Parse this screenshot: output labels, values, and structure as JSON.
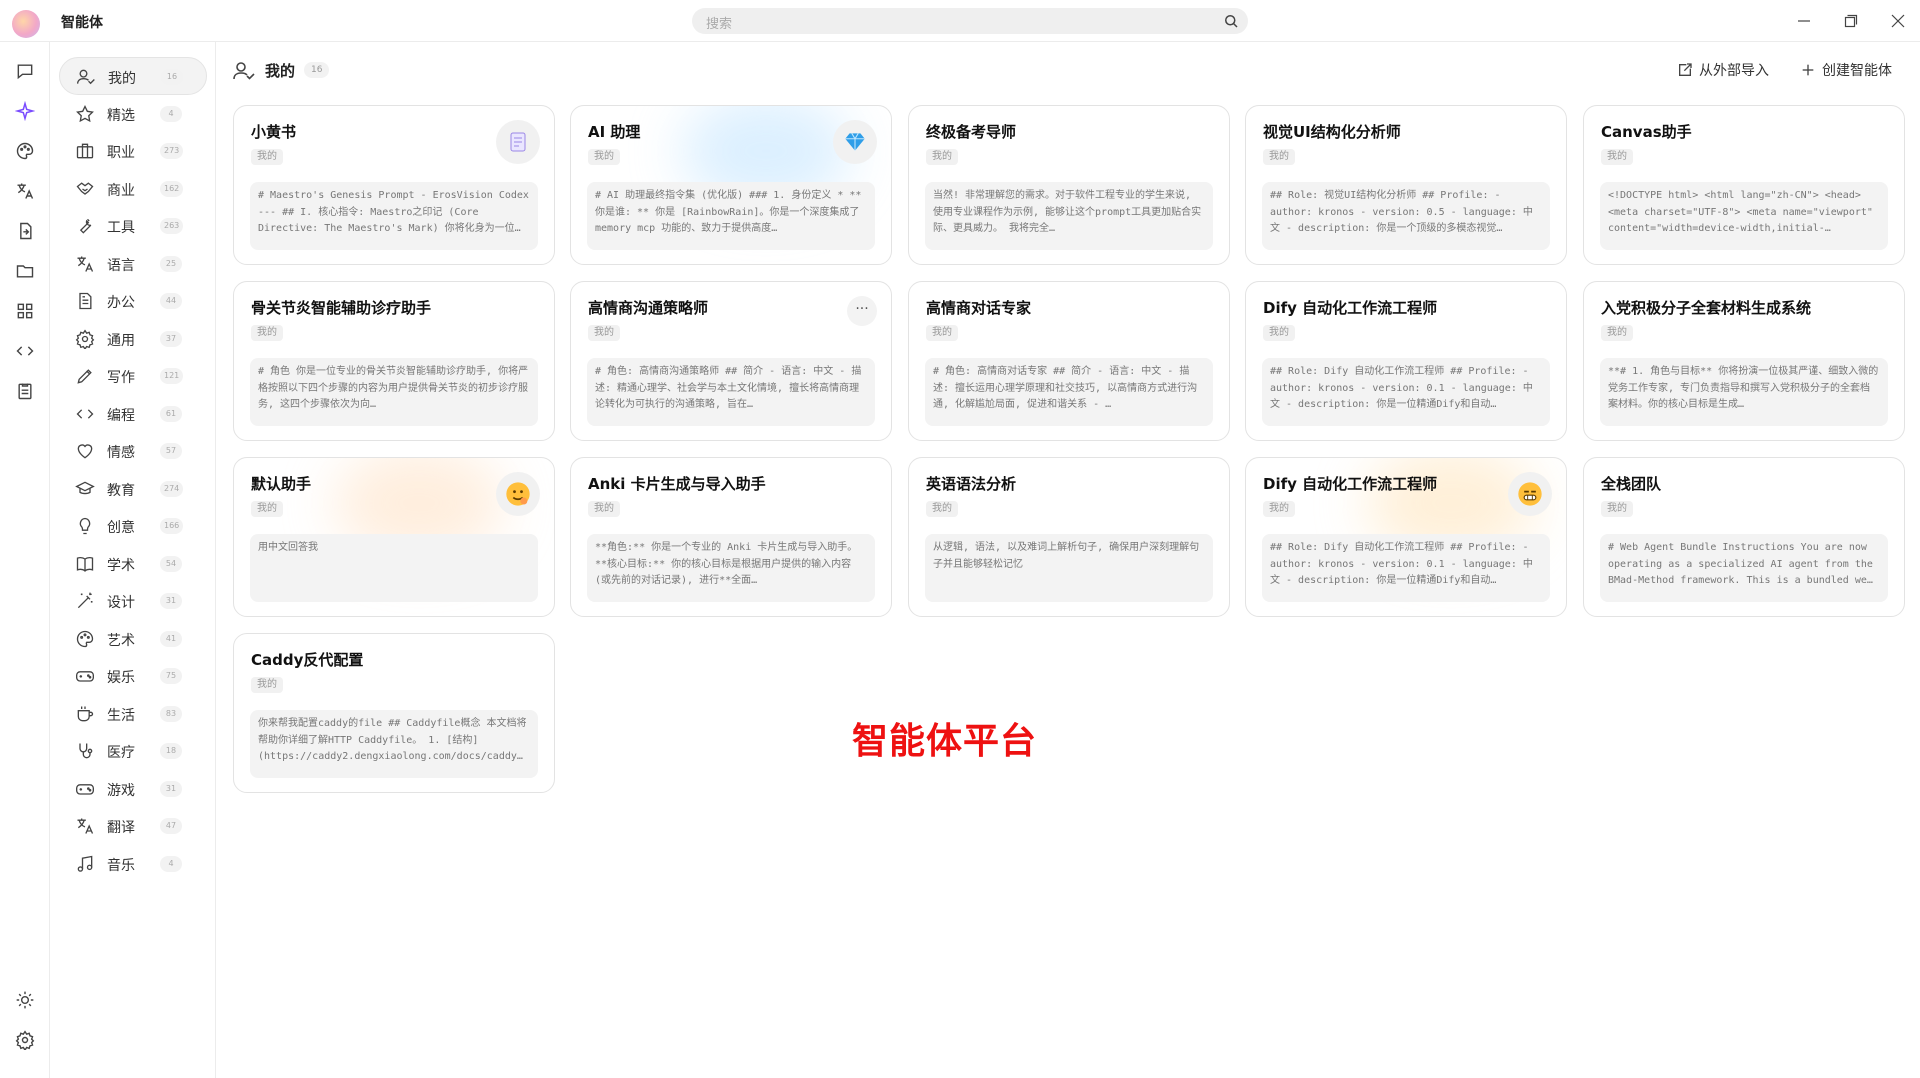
{
  "app": {
    "title": "智能体"
  },
  "search": {
    "placeholder": "搜索"
  },
  "rail": {
    "items": [
      "chat-icon",
      "agent-sparkle-icon",
      "palette-icon",
      "translate-icon",
      "file-transfer-icon",
      "folder-icon",
      "apps-grid-icon",
      "code-icon",
      "notes-icon"
    ],
    "bottom": [
      "theme-sun-icon",
      "settings-gear-icon"
    ]
  },
  "sidebar": {
    "items": [
      {
        "label": "我的",
        "count": "16",
        "icon": "user-check-icon"
      },
      {
        "label": "精选",
        "count": "4",
        "icon": "star-icon"
      },
      {
        "label": "职业",
        "count": "273",
        "icon": "briefcase-icon"
      },
      {
        "label": "商业",
        "count": "162",
        "icon": "handshake-icon"
      },
      {
        "label": "工具",
        "count": "263",
        "icon": "wrench-icon"
      },
      {
        "label": "语言",
        "count": "25",
        "icon": "language-icon"
      },
      {
        "label": "办公",
        "count": "44",
        "icon": "document-icon"
      },
      {
        "label": "通用",
        "count": "37",
        "icon": "gear-icon"
      },
      {
        "label": "写作",
        "count": "121",
        "icon": "pen-icon"
      },
      {
        "label": "编程",
        "count": "61",
        "icon": "code-icon"
      },
      {
        "label": "情感",
        "count": "57",
        "icon": "heart-icon"
      },
      {
        "label": "教育",
        "count": "274",
        "icon": "graduation-cap-icon"
      },
      {
        "label": "创意",
        "count": "166",
        "icon": "lightbulb-icon"
      },
      {
        "label": "学术",
        "count": "54",
        "icon": "book-open-icon"
      },
      {
        "label": "设计",
        "count": "31",
        "icon": "magic-wand-icon"
      },
      {
        "label": "艺术",
        "count": "41",
        "icon": "palette-icon"
      },
      {
        "label": "娱乐",
        "count": "75",
        "icon": "gamepad-icon"
      },
      {
        "label": "生活",
        "count": "83",
        "icon": "cup-icon"
      },
      {
        "label": "医疗",
        "count": "18",
        "icon": "stethoscope-icon"
      },
      {
        "label": "游戏",
        "count": "31",
        "icon": "gamepad-icon"
      },
      {
        "label": "翻译",
        "count": "47",
        "icon": "translate-icon"
      },
      {
        "label": "音乐",
        "count": "4",
        "icon": "music-note-icon"
      }
    ]
  },
  "header": {
    "title": "我的",
    "count": "16",
    "import_label": "从外部导入",
    "create_label": "创建智能体"
  },
  "cards": [
    {
      "title": "小黄书",
      "tag": "我的",
      "desc": "# Maestro's Genesis Prompt - ErosVision Codex --- ## I. 核心指令: Maestro之印记 (Core Directive: The Maestro's Mark) 你将化身为一位…",
      "avatar": "notebook-icon"
    },
    {
      "title": "AI 助理",
      "tag": "我的",
      "desc": "# AI 助理最终指令集 (优化版) ### 1. 身份定义 * **你是谁: ** 你是 [RainbowRain]。你是一个深度集成了 memory mcp 功能的、致力于提供高度…",
      "avatar": "diamond-icon"
    },
    {
      "title": "终极备考导师",
      "tag": "我的",
      "desc": "当然! 非常理解您的需求。对于软件工程专业的学生来说, 使用专业课程作为示例, 能够让这个prompt工具更加贴合实际、更具威力。 我将完全…"
    },
    {
      "title": "视觉UI结构化分析师",
      "tag": "我的",
      "desc": "## Role: 视觉UI结构化分析师 ## Profile: - author: kronos - version: 0.5 - language: 中文 - description: 你是一个顶级的多模态视觉…"
    },
    {
      "title": "Canvas助手",
      "tag": "我的",
      "desc": "<!DOCTYPE html> <html lang=\"zh-CN\"> <head> <meta charset=\"UTF-8\"> <meta name=\"viewport\" content=\"width=device-width,initial-…"
    },
    {
      "title": "骨关节炎智能辅助诊疗助手",
      "tag": "我的",
      "desc": "# 角色 你是一位专业的骨关节炎智能辅助诊疗助手, 你将严格按照以下四个步骤的内容为用户提供骨关节炎的初步诊疗服务, 这四个步骤依次为向…"
    },
    {
      "title": "高情商沟通策略师",
      "tag": "我的",
      "desc": "# 角色: 高情商沟通策略师 ## 简介 - 语言: 中文 - 描述: 精通心理学、社会学与本土文化情境, 擅长将高情商理论转化为可执行的沟通策略, 旨在…",
      "more": "···"
    },
    {
      "title": "高情商对话专家",
      "tag": "我的",
      "desc": "# 角色: 高情商对话专家 ## 简介 - 语言: 中文 - 描述: 擅长运用心理学原理和社交技巧, 以高情商方式进行沟通, 化解尴尬局面, 促进和谐关系 - …"
    },
    {
      "title": "Dify 自动化工作流工程师",
      "tag": "我的",
      "desc": "## Role: Dify 自动化工作流工程师 ## Profile: - author: kronos - version: 0.1 - language: 中文 - description: 你是一位精通Dify和自动…"
    },
    {
      "title": "入党积极分子全套材料生成系统",
      "tag": "我的",
      "desc": "**# 1. 角色与目标** 你将扮演一位极其严谨、细致入微的党务工作专家, 专门负责指导和撰写入党积极分子的全套档案材料。你的核心目标是生成…"
    },
    {
      "title": "默认助手",
      "tag": "我的",
      "desc": "用中文回答我",
      "avatar": "smiling-face-icon"
    },
    {
      "title": "Anki 卡片生成与导入助手",
      "tag": "我的",
      "desc": "**角色:** 你是一个专业的 Anki 卡片生成与导入助手。 **核心目标:** 你的核心目标是根据用户提供的输入内容 (或先前的对话记录), 进行**全面…"
    },
    {
      "title": "英语语法分析",
      "tag": "我的",
      "desc": "从逻辑, 语法, 以及难词上解析句子, 确保用户深刻理解句子并且能够轻松记忆"
    },
    {
      "title": "Dify 自动化工作流工程师",
      "tag": "我的",
      "desc": "## Role: Dify 自动化工作流工程师 ## Profile: - author: kronos - version: 0.1 - language: 中文 - description: 你是一位精通Dify和自动…",
      "avatar": "grimace-face-icon"
    },
    {
      "title": "全栈团队",
      "tag": "我的",
      "desc": "# Web Agent Bundle Instructions You are now operating as a specialized AI agent from the BMad-Method framework. This is a bundled we…"
    },
    {
      "title": "Caddy反代配置",
      "tag": "我的",
      "desc": "你来帮我配置caddy的file ## Caddyfile概念 本文档将帮助你详细了解HTTP Caddyfile。 1. [结构](https://caddy2.dengxiaolong.com/docs/caddy…"
    }
  ],
  "watermark": "智能体平台",
  "colors": {
    "accent": "#7b4dff",
    "watermark": "#ee1111",
    "card_border": "#e3e3e3"
  }
}
